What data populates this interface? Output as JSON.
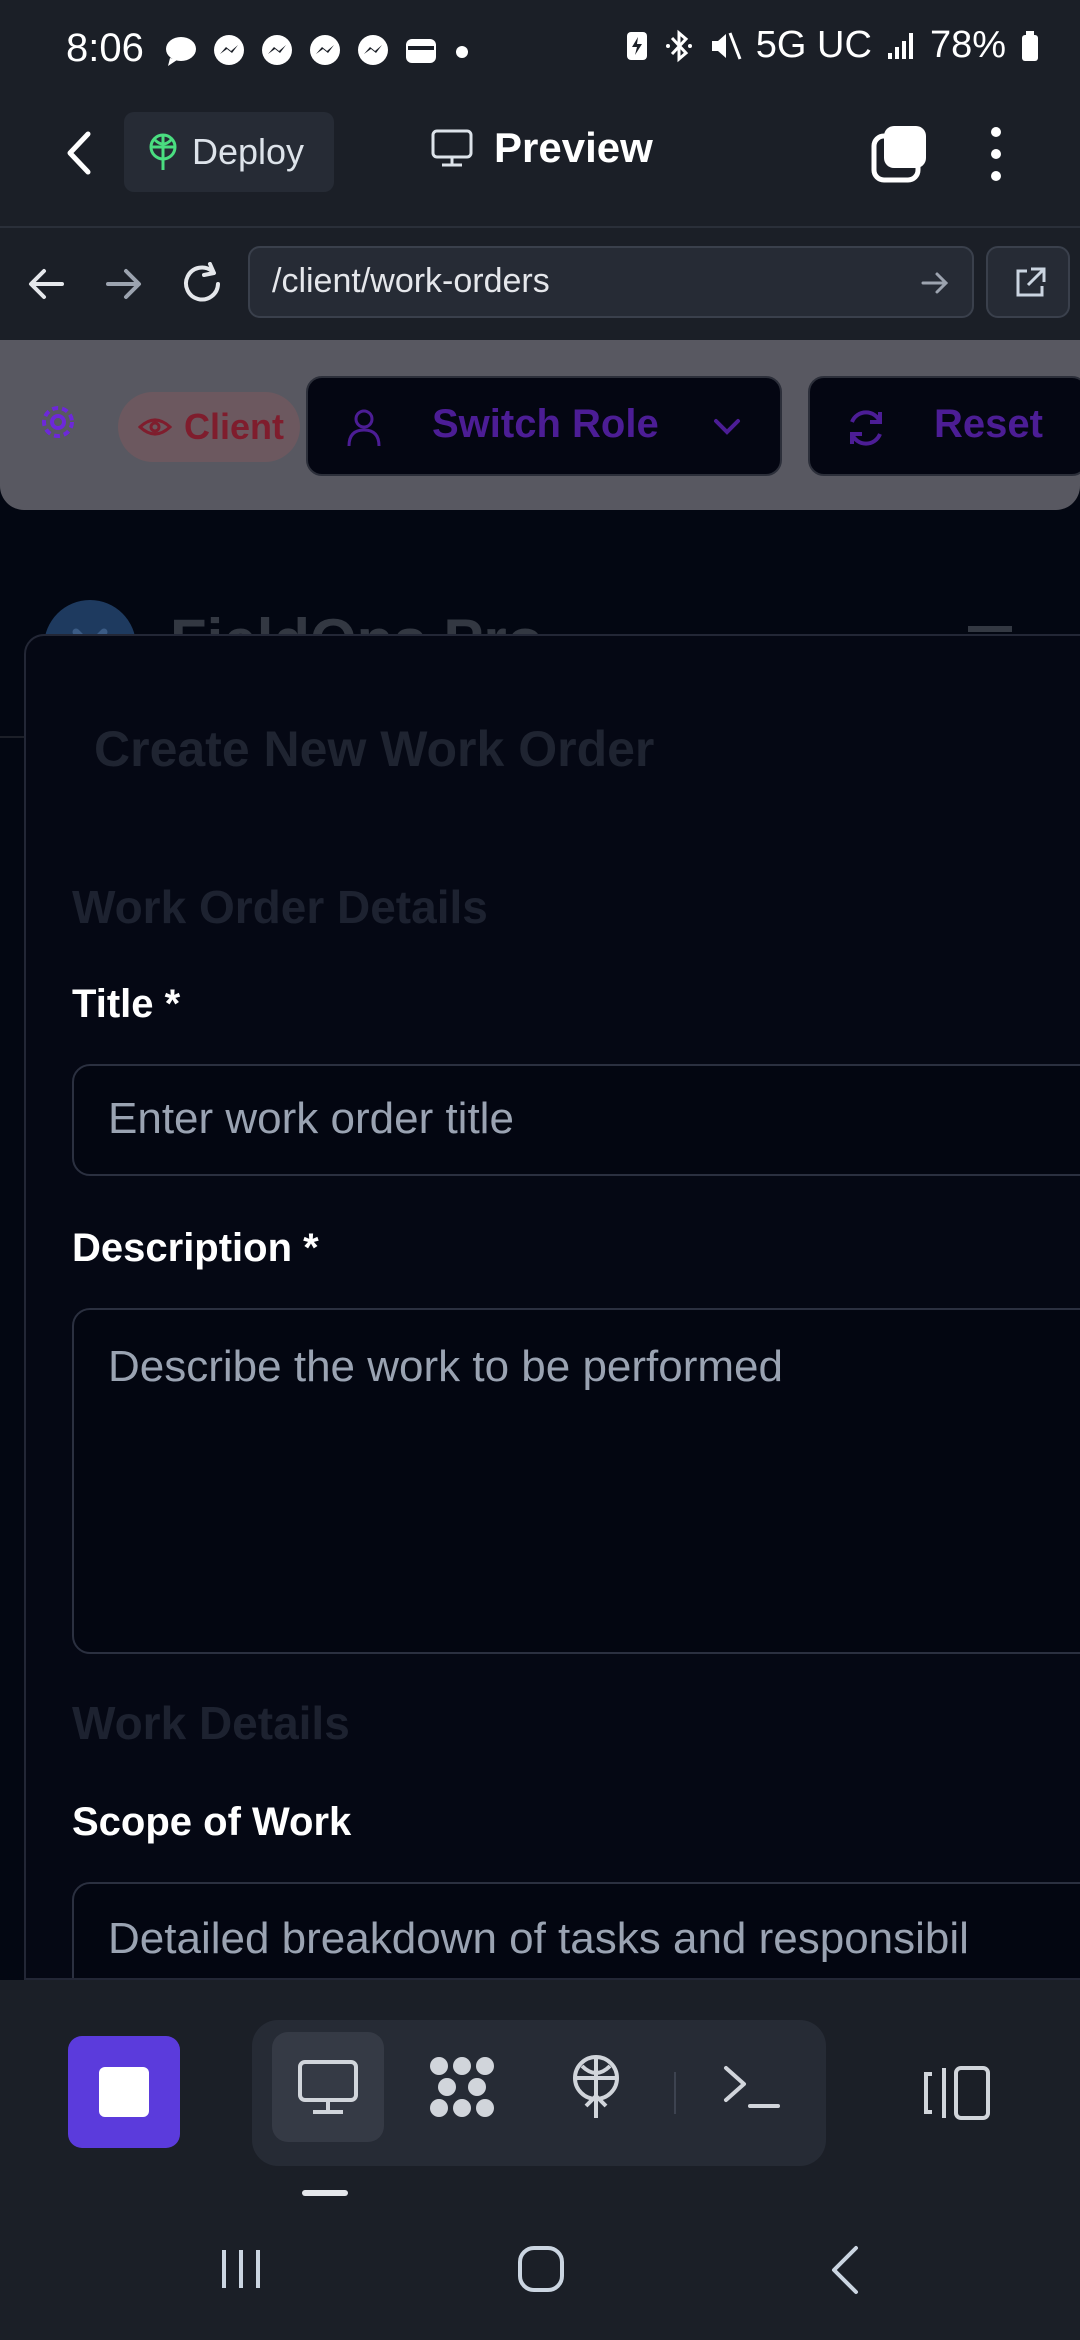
{
  "status_bar": {
    "time": "8:06",
    "network": "5G UC",
    "battery": "78%"
  },
  "app_header": {
    "deploy_label": "Deploy",
    "preview_label": "Preview"
  },
  "url_bar": {
    "url": "/client/work-orders"
  },
  "role_toolbar": {
    "client_label": "Client",
    "switch_role_label": "Switch Role",
    "reset_label": "Reset"
  },
  "background_page": {
    "brand_title": "FieldOps Pro"
  },
  "modal": {
    "title": "Create New Work Order",
    "section_details": "Work Order Details",
    "title_label": "Title *",
    "title_placeholder": "Enter work order title",
    "description_label": "Description *",
    "description_placeholder": "Describe the work to be performed",
    "section_work": "Work Details",
    "scope_label": "Scope of Work",
    "scope_placeholder": "Detailed breakdown of tasks and responsibil"
  },
  "bottom_toolbar": {
    "items": [
      "stop-icon",
      "desktop-icon",
      "grid-icon",
      "deploy-icon",
      "terminal-icon",
      "sidebar-icon"
    ]
  },
  "colors": {
    "accent": "#5b3bdc",
    "background": "#030712",
    "chrome": "#1b1f27"
  }
}
